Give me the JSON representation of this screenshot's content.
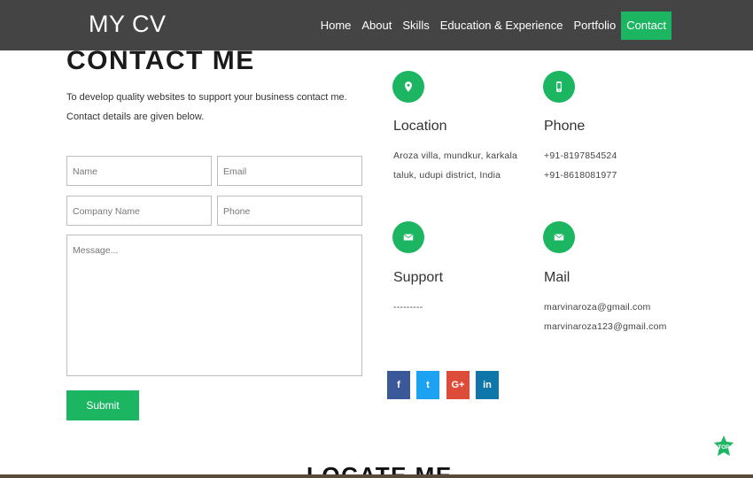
{
  "brand": "MY CV",
  "nav": [
    {
      "label": "Home"
    },
    {
      "label": "About"
    },
    {
      "label": "Skills"
    },
    {
      "label": "Education & Experience"
    },
    {
      "label": "Portfolio"
    },
    {
      "label": "Contact",
      "active": true
    }
  ],
  "contact": {
    "title": "CONTACT ME",
    "intro": "To develop quality websites to support your business contact me. Contact details are given below.",
    "form": {
      "name_placeholder": "Name",
      "email_placeholder": "Email",
      "company_placeholder": "Company Name",
      "phone_placeholder": "Phone",
      "message_placeholder": "Message...",
      "submit_label": "Submit"
    }
  },
  "info": {
    "location": {
      "title": "Location",
      "line1": "Aroza villa, mundkur, karkala",
      "line2": "taluk, udupi district, India",
      "icon": "map-pin-icon"
    },
    "phone": {
      "title": "Phone",
      "line1": "+91-8197854524",
      "line2": "+91-8618081977",
      "icon": "mobile-phone-icon"
    },
    "support": {
      "title": "Support",
      "line1": "---------",
      "icon": "envelope-icon"
    },
    "mail": {
      "title": "Mail",
      "line1": "marvinaroza@gmail.com",
      "line2": "marvinaroza123@gmail.com",
      "icon": "envelope-icon"
    }
  },
  "social": [
    {
      "name": "facebook-icon",
      "glyph": "f",
      "color": "#3b5998"
    },
    {
      "name": "twitter-icon",
      "glyph": "t",
      "color": "#1da1f2"
    },
    {
      "name": "google-plus-icon",
      "glyph": "G+",
      "color": "#dd4b39"
    },
    {
      "name": "linkedin-icon",
      "glyph": "in",
      "color": "#0e76a8"
    }
  ],
  "top_button": "TOP",
  "locate_title": "LOCATE ME",
  "colors": {
    "accent": "#1cb561",
    "navbar": "#444444"
  }
}
